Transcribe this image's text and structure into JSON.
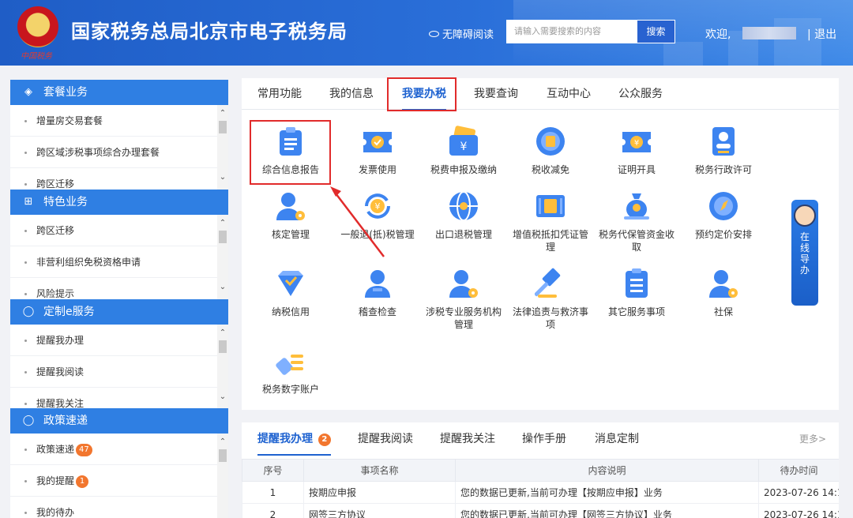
{
  "header": {
    "site_title": "国家税务总局北京市电子税务局",
    "emblem_tag": "中国税务",
    "accessibility_label": "无障碍阅读",
    "search_placeholder": "请输入需要搜索的内容",
    "search_button": "搜索",
    "welcome_label": "欢迎,",
    "logout_label": "| 退出"
  },
  "sidebar": {
    "sections": [
      {
        "title": "套餐业务",
        "icon": "layers-icon",
        "items": [
          "增量房交易套餐",
          "跨区域涉税事项综合办理套餐",
          "跨区迁移"
        ]
      },
      {
        "title": "特色业务",
        "icon": "grid-icon",
        "items": [
          "跨区迁移",
          "非营利组织免税资格申请",
          "风险提示"
        ]
      },
      {
        "title": "定制e服务",
        "icon": "user-icon",
        "items": [
          "提醒我办理",
          "提醒我阅读",
          "提醒我关注"
        ]
      },
      {
        "title": "政策速递",
        "icon": "user-icon",
        "items": [
          {
            "label": "政策速递",
            "badge": "47"
          },
          {
            "label": "我的提醒",
            "badge": "1"
          },
          {
            "label": "我的待办",
            "badge": ""
          }
        ]
      }
    ]
  },
  "main_tabs": [
    "常用功能",
    "我的信息",
    "我要办税",
    "我要查询",
    "互动中心",
    "公众服务"
  ],
  "active_tab": "我要办税",
  "functions": [
    {
      "label": "综合信息报告",
      "icon": "clipboard-icon"
    },
    {
      "label": "发票使用",
      "icon": "ticket-icon"
    },
    {
      "label": "税费申报及缴纳",
      "icon": "wallet-yen-icon"
    },
    {
      "label": "税收减免",
      "icon": "coin-icon"
    },
    {
      "label": "证明开具",
      "icon": "certificate-icon"
    },
    {
      "label": "税务行政许可",
      "icon": "id-card-icon"
    },
    {
      "label": "核定管理",
      "icon": "user-gear-icon"
    },
    {
      "label": "一般退(抵)税管理",
      "icon": "refund-icon"
    },
    {
      "label": "出口退税管理",
      "icon": "globe-icon"
    },
    {
      "label": "增值税抵扣凭证管理",
      "icon": "invoice-icon"
    },
    {
      "label": "税务代保管资金收取",
      "icon": "money-bag-icon"
    },
    {
      "label": "预约定价安排",
      "icon": "compass-icon"
    },
    {
      "label": "纳税信用",
      "icon": "diamond-icon"
    },
    {
      "label": "稽查检查",
      "icon": "inspector-icon"
    },
    {
      "label": "涉税专业服务机构管理",
      "icon": "user-gear-icon"
    },
    {
      "label": "法律追责与救济事项",
      "icon": "gavel-icon"
    },
    {
      "label": "其它服务事项",
      "icon": "document-list-icon"
    },
    {
      "label": "社保",
      "icon": "user-gear-icon"
    },
    {
      "label": "税务数字账户",
      "icon": "pen-list-icon"
    }
  ],
  "online_guide": "在线导办",
  "reminders": {
    "tabs": [
      {
        "label": "提醒我办理",
        "badge": "2"
      },
      {
        "label": "提醒我阅读",
        "badge": ""
      },
      {
        "label": "提醒我关注",
        "badge": ""
      },
      {
        "label": "操作手册",
        "badge": ""
      },
      {
        "label": "消息定制",
        "badge": ""
      }
    ],
    "more": "更多>",
    "columns": [
      "序号",
      "事项名称",
      "内容说明",
      "待办时间"
    ],
    "rows": [
      [
        "1",
        "按期应申报",
        "您的数据已更新,当前可办理【按期应申报】业务",
        "2023-07-26 14:1..."
      ],
      [
        "2",
        "网签三方协议",
        "您的数据已更新,当前可办理【网签三方协议】业务",
        "2023-07-26 14:1..."
      ]
    ]
  },
  "colors": {
    "primary": "#2f7fe3",
    "header": "#1f5dc6",
    "highlight": "#e12b2b",
    "badge": "#f2762e"
  }
}
